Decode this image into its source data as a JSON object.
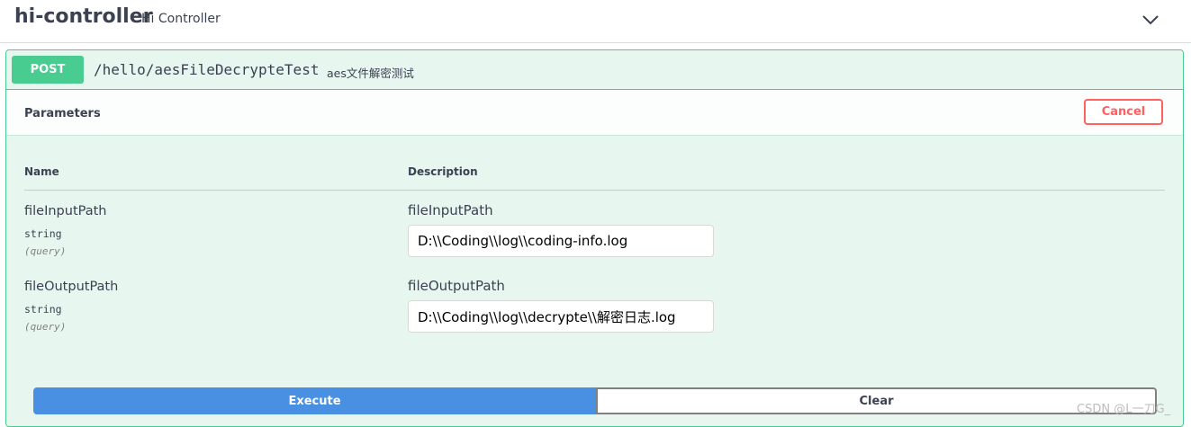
{
  "tag": {
    "title": "hi-controller",
    "description": "Hi Controller"
  },
  "operation": {
    "method": "POST",
    "path": "/hello/aesFileDecrypteTest",
    "summary": "aes文件解密测试",
    "method_color": "#49cc90"
  },
  "parameters": {
    "title": "Parameters",
    "cancel_label": "Cancel",
    "columns": {
      "name": "Name",
      "description": "Description"
    },
    "items": [
      {
        "name": "fileInputPath",
        "type": "string",
        "in": "(query)",
        "label": "fileInputPath",
        "value": "D:\\\\Coding\\\\log\\\\coding-info.log"
      },
      {
        "name": "fileOutputPath",
        "type": "string",
        "in": "(query)",
        "label": "fileOutputPath",
        "value": "D:\\\\Coding\\\\log\\\\decrypte\\\\解密日志.log"
      }
    ]
  },
  "actions": {
    "execute_label": "Execute",
    "clear_label": "Clear",
    "execute_color": "#4990e2"
  },
  "watermark": "CSDN @L一刀G_",
  "icons": {
    "collapse": "chevron-down-icon"
  }
}
